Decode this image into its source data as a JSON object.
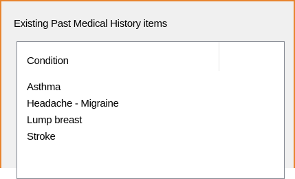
{
  "group": {
    "title": "Existing Past Medical History items"
  },
  "list": {
    "columns": [
      "Condition"
    ],
    "rows": [
      {
        "condition": "Asthma"
      },
      {
        "condition": "Headache - Migraine"
      },
      {
        "condition": "Lump breast"
      },
      {
        "condition": "Stroke"
      }
    ]
  },
  "colors": {
    "frame_border": "#e8842e",
    "panel_background": "#f0f0f0",
    "list_background": "#ffffff",
    "list_border": "#828790"
  }
}
